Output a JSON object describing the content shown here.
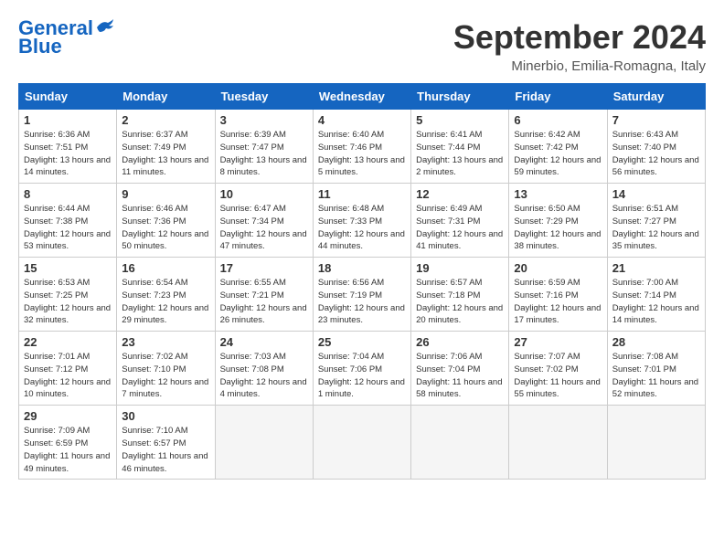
{
  "header": {
    "logo": {
      "general": "General",
      "blue": "Blue"
    },
    "title": "September 2024",
    "location": "Minerbio, Emilia-Romagna, Italy"
  },
  "weekdays": [
    "Sunday",
    "Monday",
    "Tuesday",
    "Wednesday",
    "Thursday",
    "Friday",
    "Saturday"
  ],
  "weeks": [
    [
      {
        "day": "1",
        "sunrise": "6:36 AM",
        "sunset": "7:51 PM",
        "daylight": "13 hours and 14 minutes"
      },
      {
        "day": "2",
        "sunrise": "6:37 AM",
        "sunset": "7:49 PM",
        "daylight": "13 hours and 11 minutes"
      },
      {
        "day": "3",
        "sunrise": "6:39 AM",
        "sunset": "7:47 PM",
        "daylight": "13 hours and 8 minutes"
      },
      {
        "day": "4",
        "sunrise": "6:40 AM",
        "sunset": "7:46 PM",
        "daylight": "13 hours and 5 minutes"
      },
      {
        "day": "5",
        "sunrise": "6:41 AM",
        "sunset": "7:44 PM",
        "daylight": "13 hours and 2 minutes"
      },
      {
        "day": "6",
        "sunrise": "6:42 AM",
        "sunset": "7:42 PM",
        "daylight": "12 hours and 59 minutes"
      },
      {
        "day": "7",
        "sunrise": "6:43 AM",
        "sunset": "7:40 PM",
        "daylight": "12 hours and 56 minutes"
      }
    ],
    [
      {
        "day": "8",
        "sunrise": "6:44 AM",
        "sunset": "7:38 PM",
        "daylight": "12 hours and 53 minutes"
      },
      {
        "day": "9",
        "sunrise": "6:46 AM",
        "sunset": "7:36 PM",
        "daylight": "12 hours and 50 minutes"
      },
      {
        "day": "10",
        "sunrise": "6:47 AM",
        "sunset": "7:34 PM",
        "daylight": "12 hours and 47 minutes"
      },
      {
        "day": "11",
        "sunrise": "6:48 AM",
        "sunset": "7:33 PM",
        "daylight": "12 hours and 44 minutes"
      },
      {
        "day": "12",
        "sunrise": "6:49 AM",
        "sunset": "7:31 PM",
        "daylight": "12 hours and 41 minutes"
      },
      {
        "day": "13",
        "sunrise": "6:50 AM",
        "sunset": "7:29 PM",
        "daylight": "12 hours and 38 minutes"
      },
      {
        "day": "14",
        "sunrise": "6:51 AM",
        "sunset": "7:27 PM",
        "daylight": "12 hours and 35 minutes"
      }
    ],
    [
      {
        "day": "15",
        "sunrise": "6:53 AM",
        "sunset": "7:25 PM",
        "daylight": "12 hours and 32 minutes"
      },
      {
        "day": "16",
        "sunrise": "6:54 AM",
        "sunset": "7:23 PM",
        "daylight": "12 hours and 29 minutes"
      },
      {
        "day": "17",
        "sunrise": "6:55 AM",
        "sunset": "7:21 PM",
        "daylight": "12 hours and 26 minutes"
      },
      {
        "day": "18",
        "sunrise": "6:56 AM",
        "sunset": "7:19 PM",
        "daylight": "12 hours and 23 minutes"
      },
      {
        "day": "19",
        "sunrise": "6:57 AM",
        "sunset": "7:18 PM",
        "daylight": "12 hours and 20 minutes"
      },
      {
        "day": "20",
        "sunrise": "6:59 AM",
        "sunset": "7:16 PM",
        "daylight": "12 hours and 17 minutes"
      },
      {
        "day": "21",
        "sunrise": "7:00 AM",
        "sunset": "7:14 PM",
        "daylight": "12 hours and 14 minutes"
      }
    ],
    [
      {
        "day": "22",
        "sunrise": "7:01 AM",
        "sunset": "7:12 PM",
        "daylight": "12 hours and 10 minutes"
      },
      {
        "day": "23",
        "sunrise": "7:02 AM",
        "sunset": "7:10 PM",
        "daylight": "12 hours and 7 minutes"
      },
      {
        "day": "24",
        "sunrise": "7:03 AM",
        "sunset": "7:08 PM",
        "daylight": "12 hours and 4 minutes"
      },
      {
        "day": "25",
        "sunrise": "7:04 AM",
        "sunset": "7:06 PM",
        "daylight": "12 hours and 1 minute"
      },
      {
        "day": "26",
        "sunrise": "7:06 AM",
        "sunset": "7:04 PM",
        "daylight": "11 hours and 58 minutes"
      },
      {
        "day": "27",
        "sunrise": "7:07 AM",
        "sunset": "7:02 PM",
        "daylight": "11 hours and 55 minutes"
      },
      {
        "day": "28",
        "sunrise": "7:08 AM",
        "sunset": "7:01 PM",
        "daylight": "11 hours and 52 minutes"
      }
    ],
    [
      {
        "day": "29",
        "sunrise": "7:09 AM",
        "sunset": "6:59 PM",
        "daylight": "11 hours and 49 minutes"
      },
      {
        "day": "30",
        "sunrise": "7:10 AM",
        "sunset": "6:57 PM",
        "daylight": "11 hours and 46 minutes"
      },
      null,
      null,
      null,
      null,
      null
    ]
  ]
}
